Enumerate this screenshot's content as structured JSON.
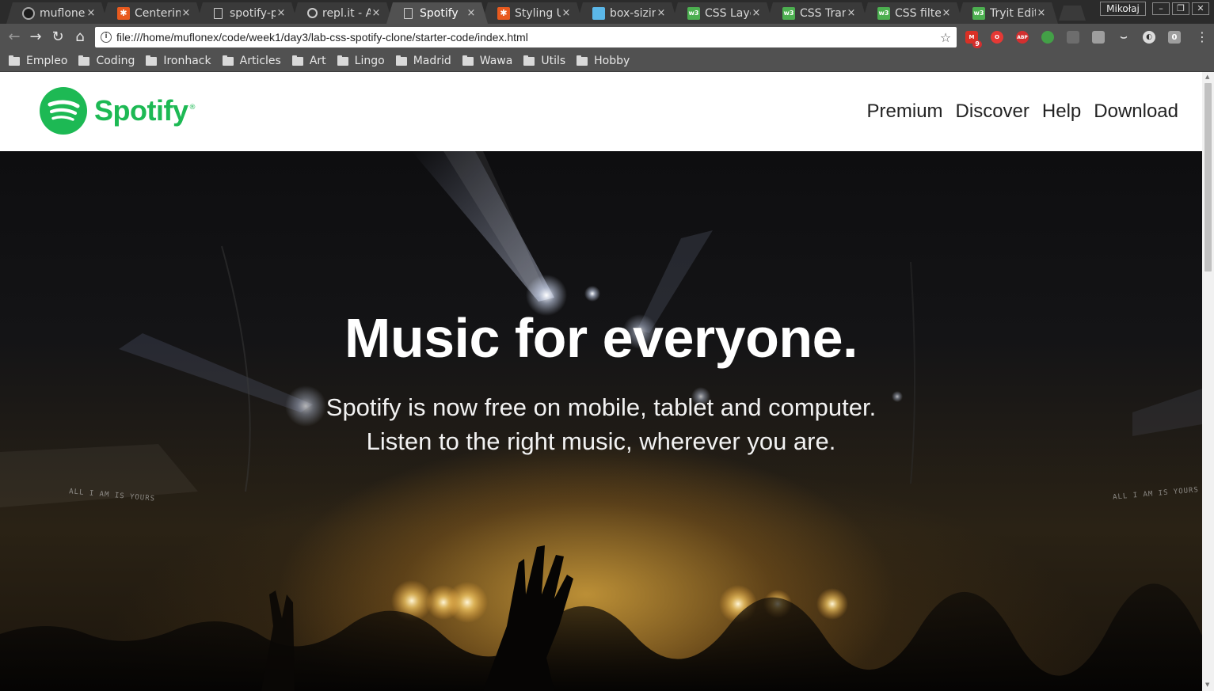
{
  "browser": {
    "tabs": [
      {
        "title": "muflonex",
        "favicon": "github-icon"
      },
      {
        "title": "Centering",
        "favicon": "asterisk-icon"
      },
      {
        "title": "spotify-p",
        "favicon": "document-icon"
      },
      {
        "title": "repl.it - A",
        "favicon": "repl-icon"
      },
      {
        "title": "Spotify",
        "favicon": "document-icon",
        "active": true
      },
      {
        "title": "Styling U",
        "favicon": "asterisk-icon"
      },
      {
        "title": "box-sizin",
        "favicon": "box-icon"
      },
      {
        "title": "CSS Layo",
        "favicon": "w3schools-icon"
      },
      {
        "title": "CSS Tran",
        "favicon": "w3schools-icon"
      },
      {
        "title": "CSS filter",
        "favicon": "w3schools-icon"
      },
      {
        "title": "Tryit Edit",
        "favicon": "w3schools-icon"
      }
    ],
    "close_glyph": "×",
    "profile_name": "Mikołaj",
    "url": "file:///home/muflonex/code/week1/day3/lab-css-spotify-clone/starter-code/index.html",
    "gmail_badge": "9",
    "abp_label": "ABP",
    "ext_counter": "0",
    "bookmarks": [
      "Empleo",
      "Coding",
      "Ironhack",
      "Articles",
      "Art",
      "Lingo",
      "Madrid",
      "Wawa",
      "Utils",
      "Hobby"
    ]
  },
  "page": {
    "brand": {
      "name": "Spotify",
      "registered": "®",
      "color": "#1db954"
    },
    "nav": [
      "Premium",
      "Discover",
      "Help",
      "Download"
    ],
    "hero": {
      "title": "Music for everyone.",
      "subtitle_line1": "Spotify is now free on mobile, tablet and computer.",
      "subtitle_line2": "Listen to the right music, wherever you are.",
      "stage_text_left": "ALL I AM IS YOURS",
      "stage_text_right": "ALL I AM IS YOURS"
    }
  }
}
